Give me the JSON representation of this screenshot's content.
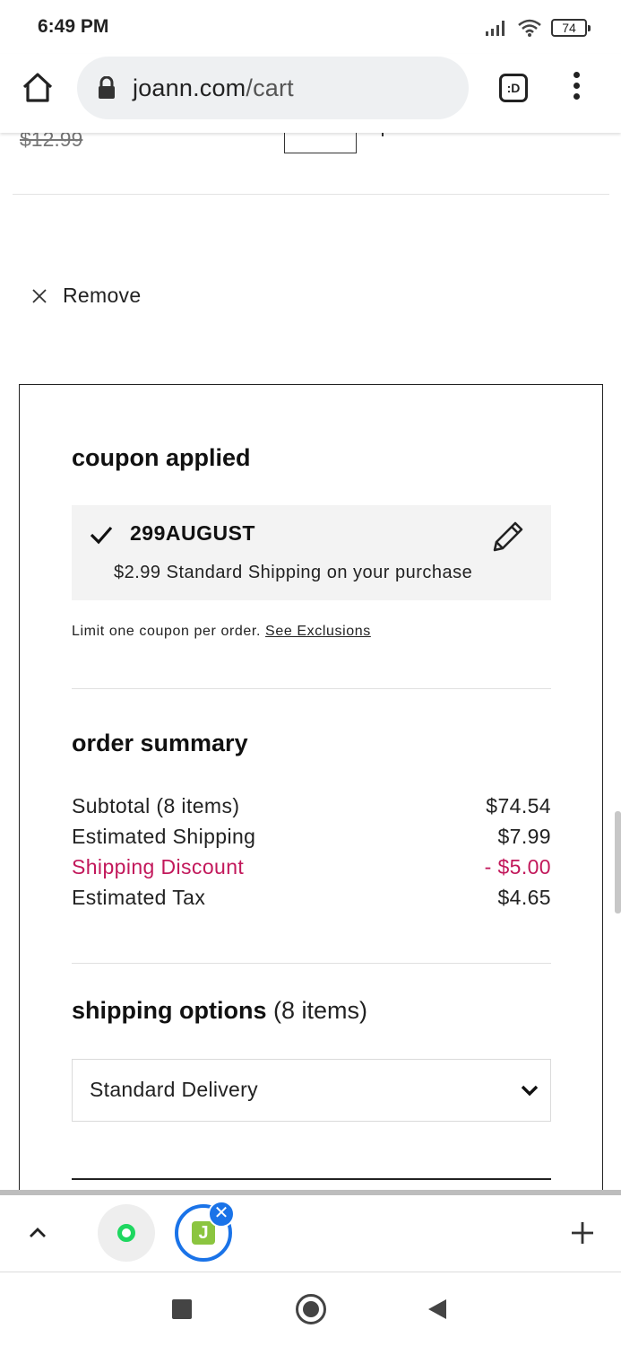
{
  "status_bar": {
    "time": "6:49 PM",
    "battery": "74"
  },
  "browser": {
    "url_host": "joann.com",
    "url_path": "/cart",
    "tab_switcher_label": ":D"
  },
  "cart": {
    "old_price": "$12.99",
    "remove_label": "Remove"
  },
  "coupon": {
    "title": "coupon applied",
    "code": "299AUGUST",
    "description": "$2.99 Standard Shipping on your purchase",
    "limit_text": "Limit one coupon per order.",
    "exclusions_link": "See Exclusions"
  },
  "order_summary": {
    "title": "order summary",
    "rows": [
      {
        "label": "Subtotal (8 items)",
        "value": "$74.54"
      },
      {
        "label": "Estimated Shipping",
        "value": "$7.99"
      },
      {
        "label": "Shipping Discount",
        "value": "- $5.00"
      },
      {
        "label": "Estimated Tax",
        "value": "$4.65"
      }
    ]
  },
  "shipping": {
    "title": "shipping options",
    "count": "(8 items)",
    "selected_option": "Standard Delivery"
  },
  "tabs": {
    "j_tab_letter": "J",
    "close_symbol": "✕"
  },
  "colors": {
    "discount": "#c2185b",
    "tab_active": "#1a73e8",
    "dot_green": "#1ed760"
  },
  "icons": {
    "home": "home-icon",
    "lock": "lock-icon",
    "menu": "more-vert-icon",
    "remove": "close-icon",
    "check": "check-icon",
    "edit": "pencil-icon",
    "dropdown": "chevron-down-icon",
    "tabs_up": "chevron-up-icon",
    "new_tab": "plus-icon"
  }
}
